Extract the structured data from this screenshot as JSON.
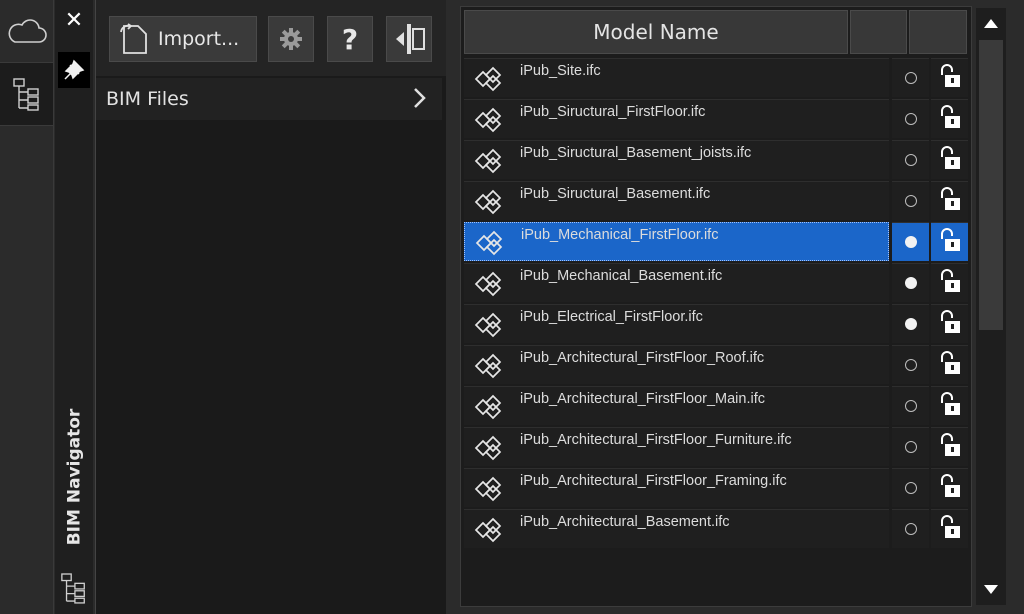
{
  "window": {
    "close_glyph": "✕"
  },
  "rail": {
    "items": [
      {
        "icon": "cloud-icon"
      },
      {
        "icon": "tree-icon"
      }
    ]
  },
  "navigator": {
    "title": "BIM Navigator"
  },
  "toolbar": {
    "import_label": "Import...",
    "help_label": "?"
  },
  "files": {
    "label": "BIM Files"
  },
  "models": {
    "header": "Model Name",
    "accent": "#1b66c9",
    "rows": [
      {
        "name": "iPub_Site.ifc",
        "visible": false,
        "selected": false
      },
      {
        "name": "iPub_Siructural_FirstFloor.ifc",
        "visible": false,
        "selected": false
      },
      {
        "name": "iPub_Siructural_Basement_joists.ifc",
        "visible": false,
        "selected": false
      },
      {
        "name": "iPub_Siructural_Basement.ifc",
        "visible": false,
        "selected": false
      },
      {
        "name": "iPub_Mechanical_FirstFloor.ifc",
        "visible": true,
        "selected": true
      },
      {
        "name": "iPub_Mechanical_Basement.ifc",
        "visible": true,
        "selected": false
      },
      {
        "name": "iPub_Electrical_FirstFloor.ifc",
        "visible": true,
        "selected": false
      },
      {
        "name": "iPub_Architectural_FirstFloor_Roof.ifc",
        "visible": false,
        "selected": false
      },
      {
        "name": "iPub_Architectural_FirstFloor_Main.ifc",
        "visible": false,
        "selected": false
      },
      {
        "name": "iPub_Architectural_FirstFloor_Furniture.ifc",
        "visible": false,
        "selected": false
      },
      {
        "name": "iPub_Architectural_FirstFloor_Framing.ifc",
        "visible": false,
        "selected": false
      },
      {
        "name": "iPub_Architectural_Basement.ifc",
        "visible": false,
        "selected": false
      }
    ]
  }
}
